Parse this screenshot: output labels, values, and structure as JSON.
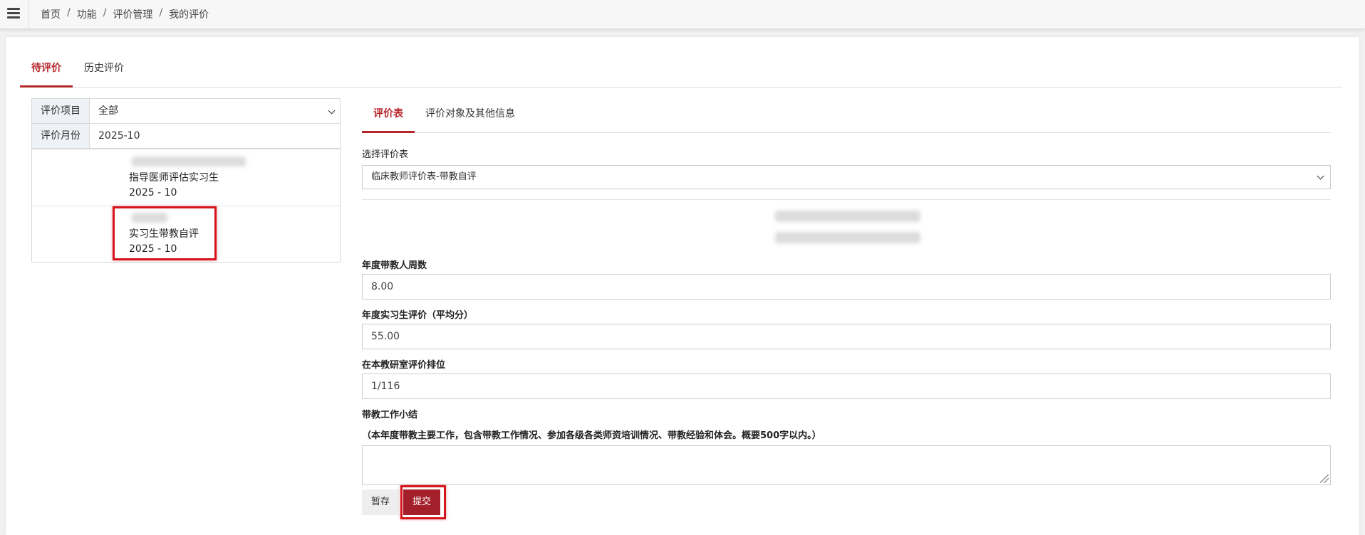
{
  "breadcrumb": [
    "首页",
    "功能",
    "评价管理",
    "我的评价"
  ],
  "main_tabs": [
    {
      "label": "待评价",
      "active": true
    },
    {
      "label": "历史评价",
      "active": false
    }
  ],
  "filters": {
    "project_label": "评价项目",
    "project_value": "全部",
    "month_label": "评价月份",
    "month_value": "2025-10"
  },
  "eval_list": [
    {
      "title": "指导医师评估实习生",
      "date": "2025 - 10"
    },
    {
      "title": "实习生带教自评",
      "date": "2025 - 10"
    }
  ],
  "sub_tabs": [
    {
      "label": "评价表",
      "active": true
    },
    {
      "label": "评价对象及其他信息",
      "active": false
    }
  ],
  "form": {
    "select_label": "选择评价表",
    "select_value": "临床教师评价表-带教自评",
    "field1_label": "年度带教人周数",
    "field1_value": "8.00",
    "field2_label": "年度实习生评价（平均分）",
    "field2_value": "55.00",
    "field3_label": "在本教研室评价排位",
    "field3_value": "1/116",
    "summary_label": "带教工作小结",
    "summary_hint": "（本年度带教主要工作，包含带教工作情况、参加各级各类师资培训情况、带教经验和体会。概要500字以内。）",
    "summary_value": ""
  },
  "buttons": {
    "save": "暂存",
    "submit": "提交"
  },
  "colors": {
    "accent": "#b7262b",
    "submit_bg": "#a31f2a",
    "highlight": "#d6141c"
  }
}
